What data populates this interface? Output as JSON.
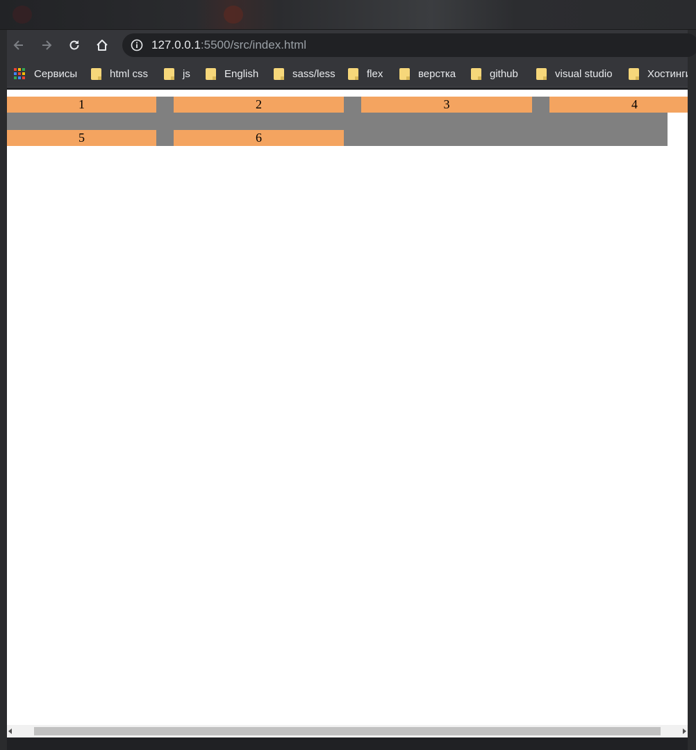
{
  "address_bar": {
    "host": "127.0.0.1",
    "rest": ":5500/src/index.html"
  },
  "bookmarks": [
    {
      "label": "Сервисы",
      "icon": "apps-icon"
    },
    {
      "label": "html css",
      "icon": "folder-icon"
    },
    {
      "label": "js",
      "icon": "folder-icon"
    },
    {
      "label": "English",
      "icon": "folder-icon"
    },
    {
      "label": "sass/less",
      "icon": "folder-icon"
    },
    {
      "label": "flex",
      "icon": "folder-icon"
    },
    {
      "label": "верстка",
      "icon": "folder-icon"
    },
    {
      "label": "github",
      "icon": "folder-icon"
    },
    {
      "label": "visual studio",
      "icon": "folder-icon"
    },
    {
      "label": "Хостинги",
      "icon": "folder-icon"
    }
  ],
  "page": {
    "container_color": "#808080",
    "item_color": "#f4a460",
    "items": [
      "1",
      "2",
      "3",
      "4",
      "5",
      "6"
    ]
  }
}
